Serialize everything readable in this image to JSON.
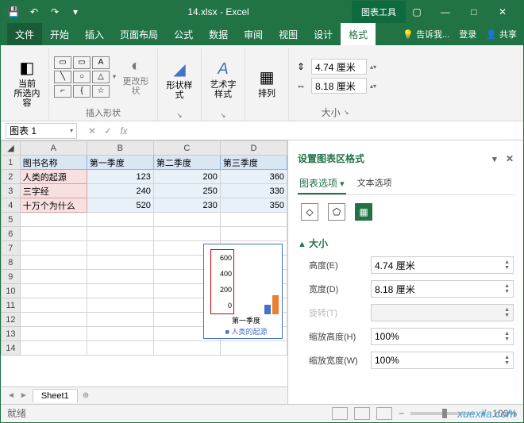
{
  "title": {
    "filename": "14.xlsx",
    "app": "Excel",
    "tooltab": "图表工具"
  },
  "tabs": {
    "file": "文件",
    "home": "开始",
    "insert": "插入",
    "layout": "页面布局",
    "formula": "公式",
    "data": "数据",
    "review": "审阅",
    "view": "视图",
    "design": "设计",
    "format": "格式",
    "tellme": "告诉我...",
    "login": "登录",
    "share": "共享"
  },
  "ribbon": {
    "selection": {
      "label": "当前\n所选内容"
    },
    "shapes": {
      "label": "插入形状"
    },
    "changeShape": {
      "label": "更改形状"
    },
    "shapeStyle": {
      "label": "形状样式"
    },
    "wordart": {
      "label": "艺术字样式"
    },
    "arrange": {
      "label": "排列"
    },
    "size": {
      "label": "大小",
      "height": "4.74 厘米",
      "width": "8.18 厘米"
    }
  },
  "namebox": "图表 1",
  "sheet": {
    "headers": {
      "A": "图书名称",
      "B": "第一季度",
      "C": "第二季度",
      "D": "第三季度"
    },
    "rows": [
      {
        "label": "人类的起源",
        "b": "123",
        "c": "200",
        "d": "360"
      },
      {
        "label": "三字经",
        "b": "240",
        "c": "250",
        "d": "330"
      },
      {
        "label": "十万个为什么",
        "b": "520",
        "c": "230",
        "d": "350"
      }
    ],
    "tab": "Sheet1"
  },
  "chart": {
    "ticks": [
      "600",
      "400",
      "200",
      "0"
    ],
    "xlabel": "第一季度",
    "legend": "■ 人类的起源"
  },
  "pane": {
    "title": "设置图表区格式",
    "tab1": "图表选项",
    "tab2": "文本选项",
    "section": "大小",
    "height": {
      "label": "高度(E)",
      "value": "4.74 厘米"
    },
    "width": {
      "label": "宽度(D)",
      "value": "8.18 厘米"
    },
    "rotation": {
      "label": "旋转(T)"
    },
    "scaleH": {
      "label": "缩放高度(H)",
      "value": "100%"
    },
    "scaleW": {
      "label": "缩放宽度(W)",
      "value": "100%"
    }
  },
  "status": {
    "mode": "就绪",
    "zoom": "100%"
  },
  "watermark": "xuexila.com"
}
